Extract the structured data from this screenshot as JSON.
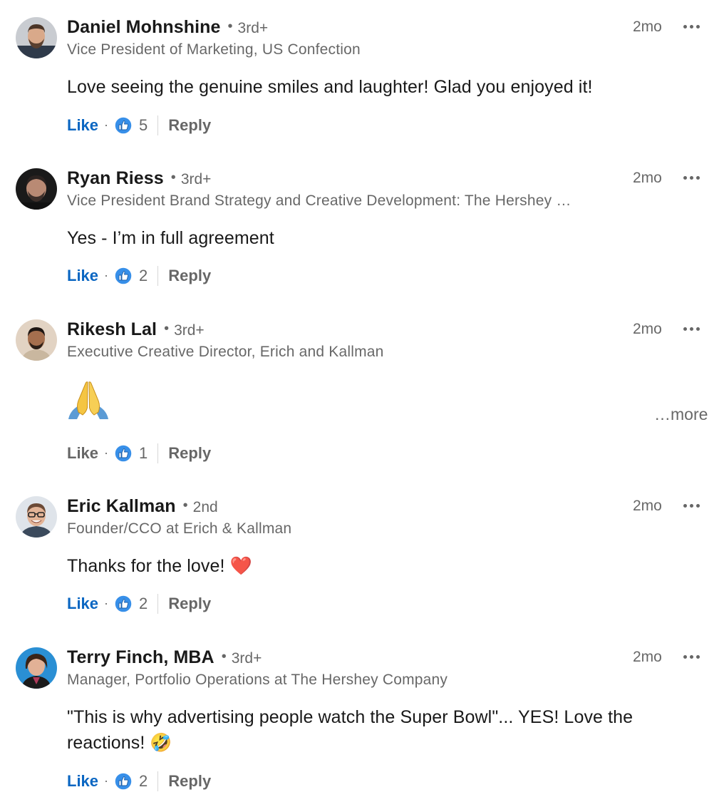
{
  "comments": [
    {
      "author": "Daniel Mohnshine",
      "separator": "•",
      "degree": "3rd+",
      "headline": "Vice President of Marketing, US Confection",
      "time": "2mo",
      "text": "Love seeing the genuine smiles and laughter! Glad you enjoyed it!",
      "like_label": "Like",
      "dot": "·",
      "reaction_count": "5",
      "reply_label": "Reply"
    },
    {
      "author": "Ryan Riess",
      "separator": "•",
      "degree": "3rd+",
      "headline": "Vice President Brand Strategy and Creative Development: The Hershey …",
      "time": "2mo",
      "text": "Yes - I’m in full agreement",
      "like_label": "Like",
      "dot": "·",
      "reaction_count": "2",
      "reply_label": "Reply"
    },
    {
      "author": "Rikesh Lal",
      "separator": "•",
      "degree": "3rd+",
      "headline": "Executive Creative Director, Erich and Kallman",
      "time": "2mo",
      "text_emoji": "folded-hands-emoji",
      "see_more": "…more",
      "like_label": "Like",
      "dot": "·",
      "reaction_count": "1",
      "reply_label": "Reply"
    },
    {
      "author": "Eric Kallman",
      "separator": "•",
      "degree": "2nd",
      "headline": "Founder/CCO at Erich & Kallman",
      "time": "2mo",
      "text": "Thanks for the love! ❤️",
      "like_label": "Like",
      "dot": "·",
      "reaction_count": "2",
      "reply_label": "Reply"
    },
    {
      "author": "Terry Finch, MBA",
      "separator": "•",
      "degree": "3rd+",
      "headline": "Manager, Portfolio Operations at The Hershey Company",
      "time": "2mo",
      "text": "\"This is why advertising people watch the Super Bowl\"... YES! Love the reactions! 🤣",
      "like_label": "Like",
      "dot": "·",
      "reaction_count": "2",
      "reply_label": "Reply"
    }
  ],
  "colors": {
    "like_active": "#0a66c2",
    "reaction_blue": "#378fe9",
    "text_primary": "#1f1f1f",
    "text_secondary": "#666666"
  },
  "icons": {
    "overflow": "three-dots-icon",
    "reaction": "like-thumb-reaction-icon"
  }
}
